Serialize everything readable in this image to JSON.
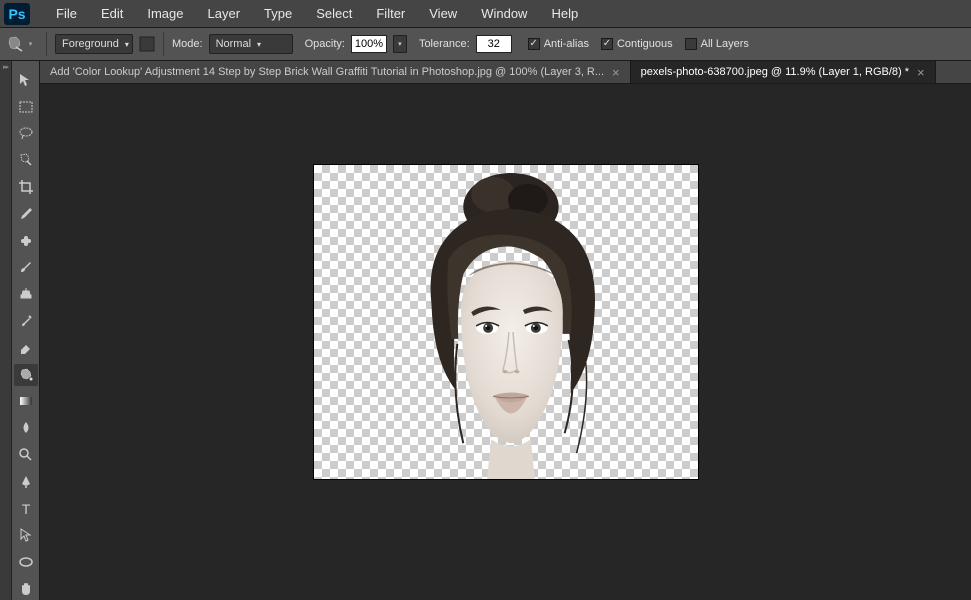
{
  "app": {
    "logo_text": "Ps"
  },
  "menu": [
    "File",
    "Edit",
    "Image",
    "Layer",
    "Type",
    "Select",
    "Filter",
    "View",
    "Window",
    "Help"
  ],
  "options": {
    "fill_mode": "Foreground",
    "mode_label": "Mode:",
    "blend_mode": "Normal",
    "opacity_label": "Opacity:",
    "opacity_value": "100%",
    "tolerance_label": "Tolerance:",
    "tolerance_value": "32",
    "anti_alias_label": "Anti-alias",
    "anti_alias_checked": true,
    "contiguous_label": "Contiguous",
    "contiguous_checked": true,
    "all_layers_label": "All Layers",
    "all_layers_checked": false
  },
  "tabs": [
    {
      "label": "Add 'Color Lookup' Adjustment 14 Step by Step Brick Wall Graffiti Tutorial in Photoshop.jpg @ 100% (Layer 3, R...",
      "active": false
    },
    {
      "label": "pexels-photo-638700.jpeg @ 11.9% (Layer 1, RGB/8) *",
      "active": true
    }
  ],
  "tools": [
    "move-tool",
    "marquee-tool",
    "lasso-tool",
    "quick-select-tool",
    "crop-tool",
    "eyedropper-tool",
    "healing-brush-tool",
    "brush-tool",
    "clone-stamp-tool",
    "history-brush-tool",
    "eraser-tool",
    "paint-bucket-tool",
    "gradient-tool",
    "blur-tool",
    "dodge-tool",
    "pen-tool",
    "type-tool",
    "path-select-tool",
    "ellipse-tool",
    "hand-tool"
  ],
  "selected_tool_index": 11
}
